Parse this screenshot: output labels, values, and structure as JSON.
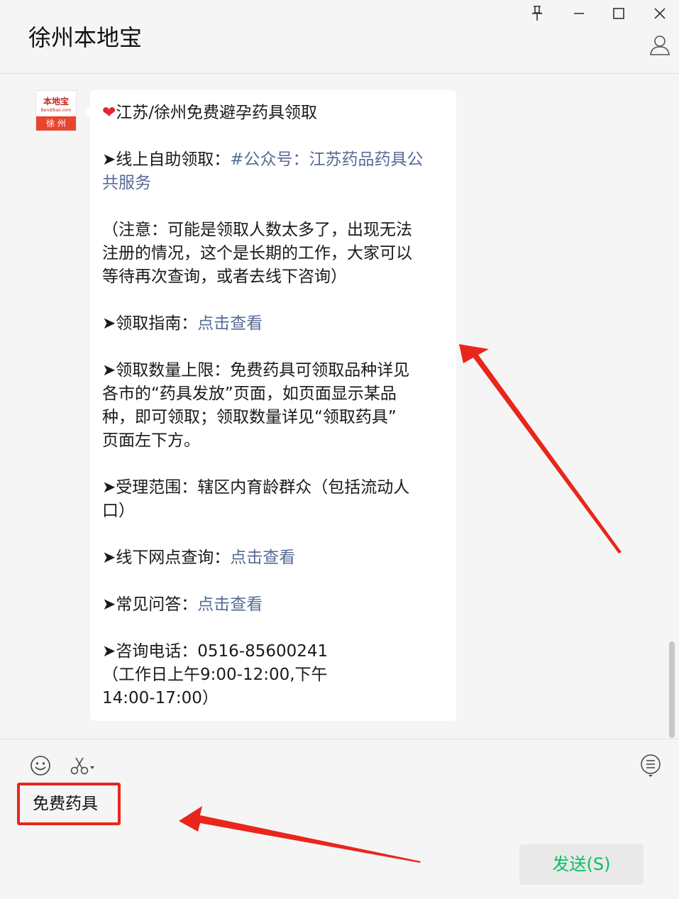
{
  "window": {
    "title": "徐州本地宝",
    "controls": {
      "pin_icon": "pin-icon",
      "minimize_icon": "minimize-icon",
      "maximize_icon": "maximize-icon",
      "close_icon": "close-icon",
      "profile_icon": "profile-icon"
    }
  },
  "sender": {
    "avatar_top": "本地宝",
    "avatar_url": "Bendibao.com",
    "avatar_city": "徐 州"
  },
  "message": {
    "lines": [
      {
        "parts": [
          {
            "t": "❤",
            "c": "heart"
          },
          {
            "t": "江苏/徐州免费避孕药具领取"
          }
        ]
      },
      {
        "blank": true
      },
      {
        "parts": [
          {
            "t": "➤线上自助领取："
          },
          {
            "t": "#公众号：江苏药品药具公",
            "c": "link"
          }
        ]
      },
      {
        "parts": [
          {
            "t": "共服务",
            "c": "link"
          }
        ]
      },
      {
        "blank": true
      },
      {
        "parts": [
          {
            "t": "（注意：可能是领取人数太多了，出现无法"
          }
        ]
      },
      {
        "parts": [
          {
            "t": "注册的情况，这个是长期的工作，大家可以"
          }
        ]
      },
      {
        "parts": [
          {
            "t": "等待再次查询，或者去线下咨询）"
          }
        ]
      },
      {
        "blank": true
      },
      {
        "parts": [
          {
            "t": "➤领取指南："
          },
          {
            "t": "点击查看",
            "c": "link"
          }
        ]
      },
      {
        "blank": true
      },
      {
        "parts": [
          {
            "t": "➤领取数量上限：免费药具可领取品种详见"
          }
        ]
      },
      {
        "parts": [
          {
            "t": "各市的“药具发放”页面，如页面显示某品"
          }
        ]
      },
      {
        "parts": [
          {
            "t": "种，即可领取；领取数量详见“领取药具”"
          }
        ]
      },
      {
        "parts": [
          {
            "t": "页面左下方。"
          }
        ]
      },
      {
        "blank": true
      },
      {
        "parts": [
          {
            "t": "➤受理范围：辖区内育龄群众（包括流动人"
          }
        ]
      },
      {
        "parts": [
          {
            "t": "口）"
          }
        ]
      },
      {
        "blank": true
      },
      {
        "parts": [
          {
            "t": "➤线下网点查询："
          },
          {
            "t": "点击查看",
            "c": "link"
          }
        ]
      },
      {
        "blank": true
      },
      {
        "parts": [
          {
            "t": "➤常见问答："
          },
          {
            "t": "点击查看",
            "c": "link"
          }
        ]
      },
      {
        "blank": true
      },
      {
        "parts": [
          {
            "t": "➤咨询电话：0516-85600241"
          }
        ]
      },
      {
        "parts": [
          {
            "t": "（工作日上午9:00-12:00,下午"
          }
        ]
      },
      {
        "parts": [
          {
            "t": "14:00-17:00）"
          }
        ]
      }
    ]
  },
  "composer": {
    "emoji_icon": "emoji-icon",
    "scissors_icon": "scissors-icon",
    "menu_icon": "menu-list-icon",
    "input_value": "免费药具",
    "send_label": "发送(S)"
  },
  "annotations": {
    "color": "#e8261c",
    "arrow_icon": "arrow-icon"
  }
}
